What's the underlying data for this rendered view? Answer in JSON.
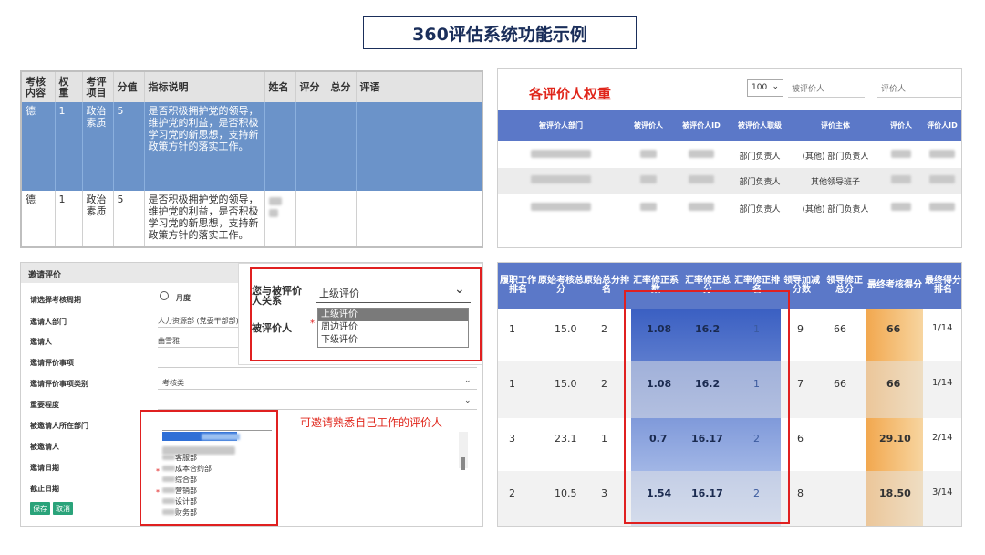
{
  "title": "360评估系统功能示例",
  "panelA": {
    "headers": [
      "考核内容",
      "权重",
      "考评项目",
      "分值",
      "指标说明",
      "姓名",
      "评分",
      "总分",
      "评语"
    ],
    "rows": [
      {
        "content": "德",
        "weight": "1",
        "item": "政治素质",
        "score": "5",
        "desc": "是否积极拥护党的领导，维护党的利益，是否积极学习党的新思想，支持新政策方针的落实工作。"
      },
      {
        "content": "德",
        "weight": "1",
        "item": "政治素质",
        "score": "5",
        "desc": "是否积极拥护党的领导，维护党的利益，是否积极学习党的新思想，支持新政策方针的落实工作。"
      }
    ]
  },
  "panelB": {
    "heading": "各评价人权重",
    "page_size": "100",
    "search1_placeholder": "被评价人",
    "search2_placeholder": "评价人",
    "headers": [
      "被评价人部门",
      "被评价人",
      "被评价人ID",
      "被评价人职级",
      "评价主体",
      "评价人",
      "评价人ID"
    ],
    "rows": [
      {
        "rank": "部门负责人",
        "subject": "(其他) 部门负责人"
      },
      {
        "rank": "部门负责人",
        "subject": "其他领导班子"
      },
      {
        "rank": "部门负责人",
        "subject": "(其他) 部门负责人"
      }
    ]
  },
  "panelC": {
    "header": "邀请评价",
    "labels": [
      "请选择考核周期",
      "邀请人部门",
      "邀请人",
      "邀请评价事项",
      "邀请评价事项类别",
      "重要程度",
      "被邀请人所在部门",
      "被邀请人",
      "邀请日期",
      "截止日期"
    ],
    "period_option": "月度",
    "dept_value": "人力资源部 (党委干部部)",
    "inviter_value": "曲雪雅",
    "category_value": "考核类",
    "relation_label": "您与被评价人关系",
    "relation_value": "上级评价",
    "evaluatee_label": "被评价人",
    "required_mark": "*",
    "relation_options": [
      "上级评价",
      "周边评价",
      "下级评价"
    ],
    "dept_options": [
      "客服部",
      "成本合约部",
      "综合部",
      "营销部",
      "设计部",
      "财务部"
    ],
    "annotation": "可邀请熟悉自己工作的评价人",
    "save_label": "保存",
    "cancel_label": "取消"
  },
  "panelD": {
    "headers": [
      "履职工作排名",
      "原始考核总分",
      "原始总分排名",
      "汇率修正系数",
      "汇率修正总分",
      "汇率修正排名",
      "领导加减分数",
      "领导修正总分",
      "最终考核得分",
      "最终得分排名"
    ],
    "rows": [
      {
        "rank": "1",
        "raw": "15.0",
        "raw_rank": "2",
        "coef": "1.08",
        "corr": "16.2",
        "corr_rank": "1",
        "lead": "9",
        "lead_total": "66",
        "final": "66",
        "final_rank": "1/14"
      },
      {
        "rank": "1",
        "raw": "15.0",
        "raw_rank": "2",
        "coef": "1.08",
        "corr": "16.2",
        "corr_rank": "1",
        "lead": "7",
        "lead_total": "66",
        "final": "66",
        "final_rank": "1/14"
      },
      {
        "rank": "3",
        "raw": "23.1",
        "raw_rank": "1",
        "coef": "0.7",
        "corr": "16.17",
        "corr_rank": "2",
        "lead": "6",
        "lead_total": "",
        "final": "29.10",
        "final_rank": "2/14"
      },
      {
        "rank": "2",
        "raw": "10.5",
        "raw_rank": "3",
        "coef": "1.54",
        "corr": "16.17",
        "corr_rank": "2",
        "lead": "8",
        "lead_total": "",
        "final": "18.50",
        "final_rank": "3/14"
      }
    ]
  },
  "colors": {
    "accent_blue": "#5b78c8",
    "highlight_red": "#e02020",
    "orange": "#f2a84f",
    "green": "#2aa37a",
    "title_navy": "#1a2e5a"
  }
}
